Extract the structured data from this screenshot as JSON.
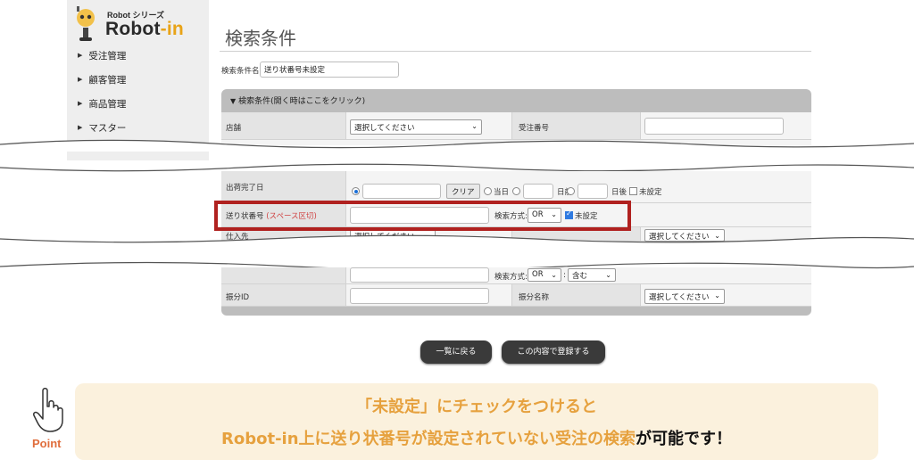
{
  "sidebar": {
    "logo_small": "Robot シリーズ",
    "logo_big": "Robot",
    "logo_accent": "-in",
    "items": [
      {
        "label": "受注管理"
      },
      {
        "label": "顧客管理"
      },
      {
        "label": "商品管理"
      },
      {
        "label": "マスター"
      }
    ]
  },
  "page": {
    "title": "検索条件",
    "condition_name_label": "検索条件名",
    "condition_name_value": "送り状番号未設定"
  },
  "panel": {
    "header": "検索条件(開く時はここをクリック)",
    "store_label": "店舗",
    "store_select": "選択してください",
    "order_no_label": "受注番号",
    "clear": "クリア",
    "today": "当日",
    "days_before": "日前",
    "days_after": "日後",
    "unset": "未設定",
    "ship_done_label": "出荷完了日",
    "tracking_label": "送り状番号",
    "tracking_hint": "(スペース区切)",
    "search_method_label": "検索方式:",
    "search_method_value": "OR",
    "tracking_unset_label": "未設定",
    "supplier_label": "仕入先",
    "supplier_select": "選択してください",
    "warehouse_select": "選択してください",
    "contains": "含む",
    "allocation_id_label": "振分ID",
    "allocation_name_label": "振分名称",
    "allocation_name_select": "選択してください"
  },
  "buttons": {
    "back": "一覧に戻る",
    "register": "この内容で登録する"
  },
  "point": {
    "label": "Point",
    "line1": "「未設定」にチェックをつけると",
    "line2_orange": "Robot-in上に送り状番号が設定されていない受注の検索",
    "line2_black": "が可能です！"
  },
  "colors": {
    "highlight": "#b0211f",
    "accent_orange": "#e6a13e",
    "point_bg": "#fbf1dd"
  }
}
